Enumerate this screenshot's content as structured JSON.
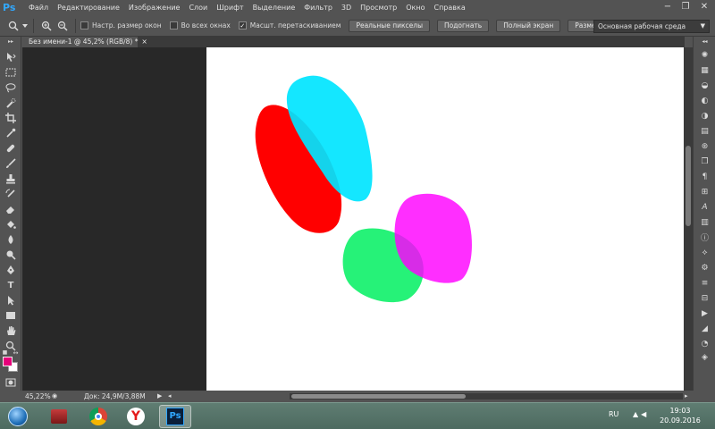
{
  "app": {
    "logo": "Ps"
  },
  "menu": [
    "Файл",
    "Редактирование",
    "Изображение",
    "Слои",
    "Шрифт",
    "Выделение",
    "Фильтр",
    "3D",
    "Просмотр",
    "Окно",
    "Справка"
  ],
  "window_controls": {
    "minimize": "−",
    "restore": "❐",
    "close": "✕"
  },
  "options": {
    "checkboxes": [
      {
        "label": "Настр. размер окон",
        "checked": false
      },
      {
        "label": "Во всех окнах",
        "checked": false
      },
      {
        "label": "Масшт. перетаскиванием",
        "checked": true
      }
    ],
    "buttons": [
      "Реальные пикселы",
      "Подогнать",
      "Полный экран",
      "Размер оттиска"
    ],
    "workspace": "Основная рабочая среда"
  },
  "document": {
    "tab_title": "Без имени-1 @ 45,2% (RGB/8) *",
    "tab_close": "×"
  },
  "status": {
    "zoom": "45,22%",
    "doc_info": "Док: 24,9M/3,88M"
  },
  "colors": {
    "foreground": "#e6007a",
    "background": "#ffffff",
    "accent": "#31a8ff"
  },
  "taskbar": {
    "language": "RU",
    "time": "19:03",
    "date": "20.09.2016",
    "yandex_letter": "Y",
    "ps_label": "Ps"
  }
}
